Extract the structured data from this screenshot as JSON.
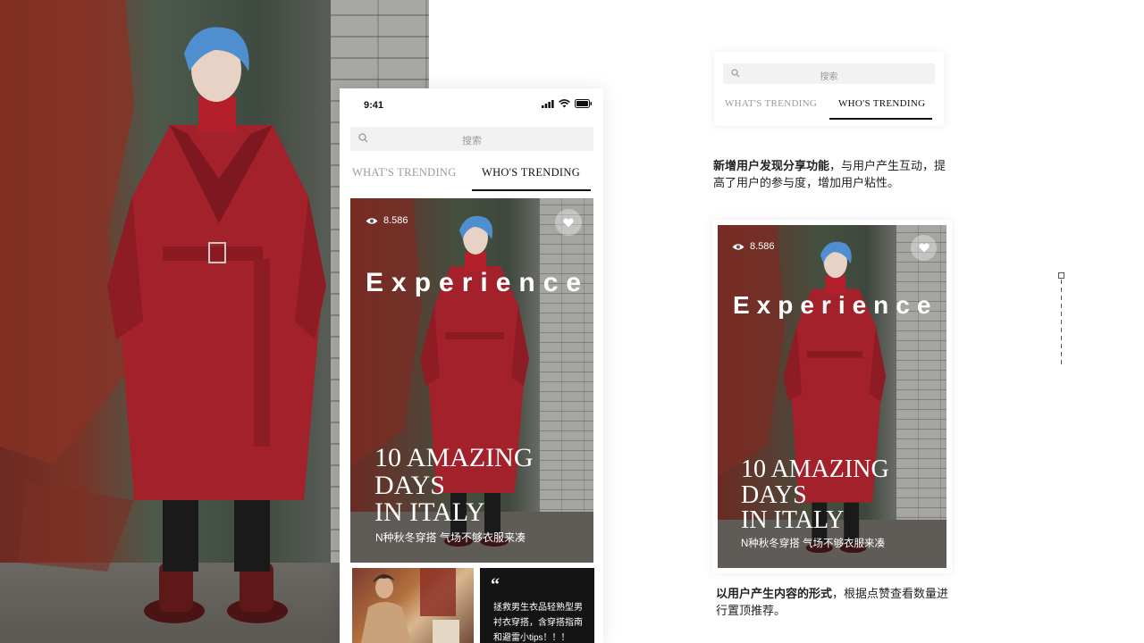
{
  "phone": {
    "time": "9:41",
    "search_placeholder": "搜索",
    "tabs": [
      {
        "label": "WHAT'S TRENDING",
        "active": false
      },
      {
        "label": "WHO'S TRENDING",
        "active": true
      }
    ]
  },
  "feature_card": {
    "views": "8.586",
    "title": "Experience",
    "headline": [
      "10 AMAZING",
      "DAYS",
      "IN ITALY"
    ],
    "subtitle": "N种秋冬穿搭 气场不够衣服来凑"
  },
  "quote_card": {
    "mark": "“",
    "text": "拯救男生衣品轻熟型男衬衣穿搭，含穿搭指南和避雷小tips！！！"
  },
  "annotations": {
    "mini_search_placeholder": "搜索",
    "mini_tabs": [
      {
        "label": "WHAT'S TRENDING",
        "active": false
      },
      {
        "label": "WHO'S TRENDING",
        "active": true
      }
    ],
    "desc1_bold": "新增用户发现分享功能",
    "desc1_rest": "，与用户产生互动，提高了用户的参与度，增加用户粘性。",
    "desc2_bold": "以用户产生内容的形式",
    "desc2_rest": "，根据点赞查看数量进行置顶推荐。"
  },
  "colors": {
    "coat_red": "#a3212a",
    "hair_blue": "#4f8fd0",
    "accent_black": "#111111"
  }
}
